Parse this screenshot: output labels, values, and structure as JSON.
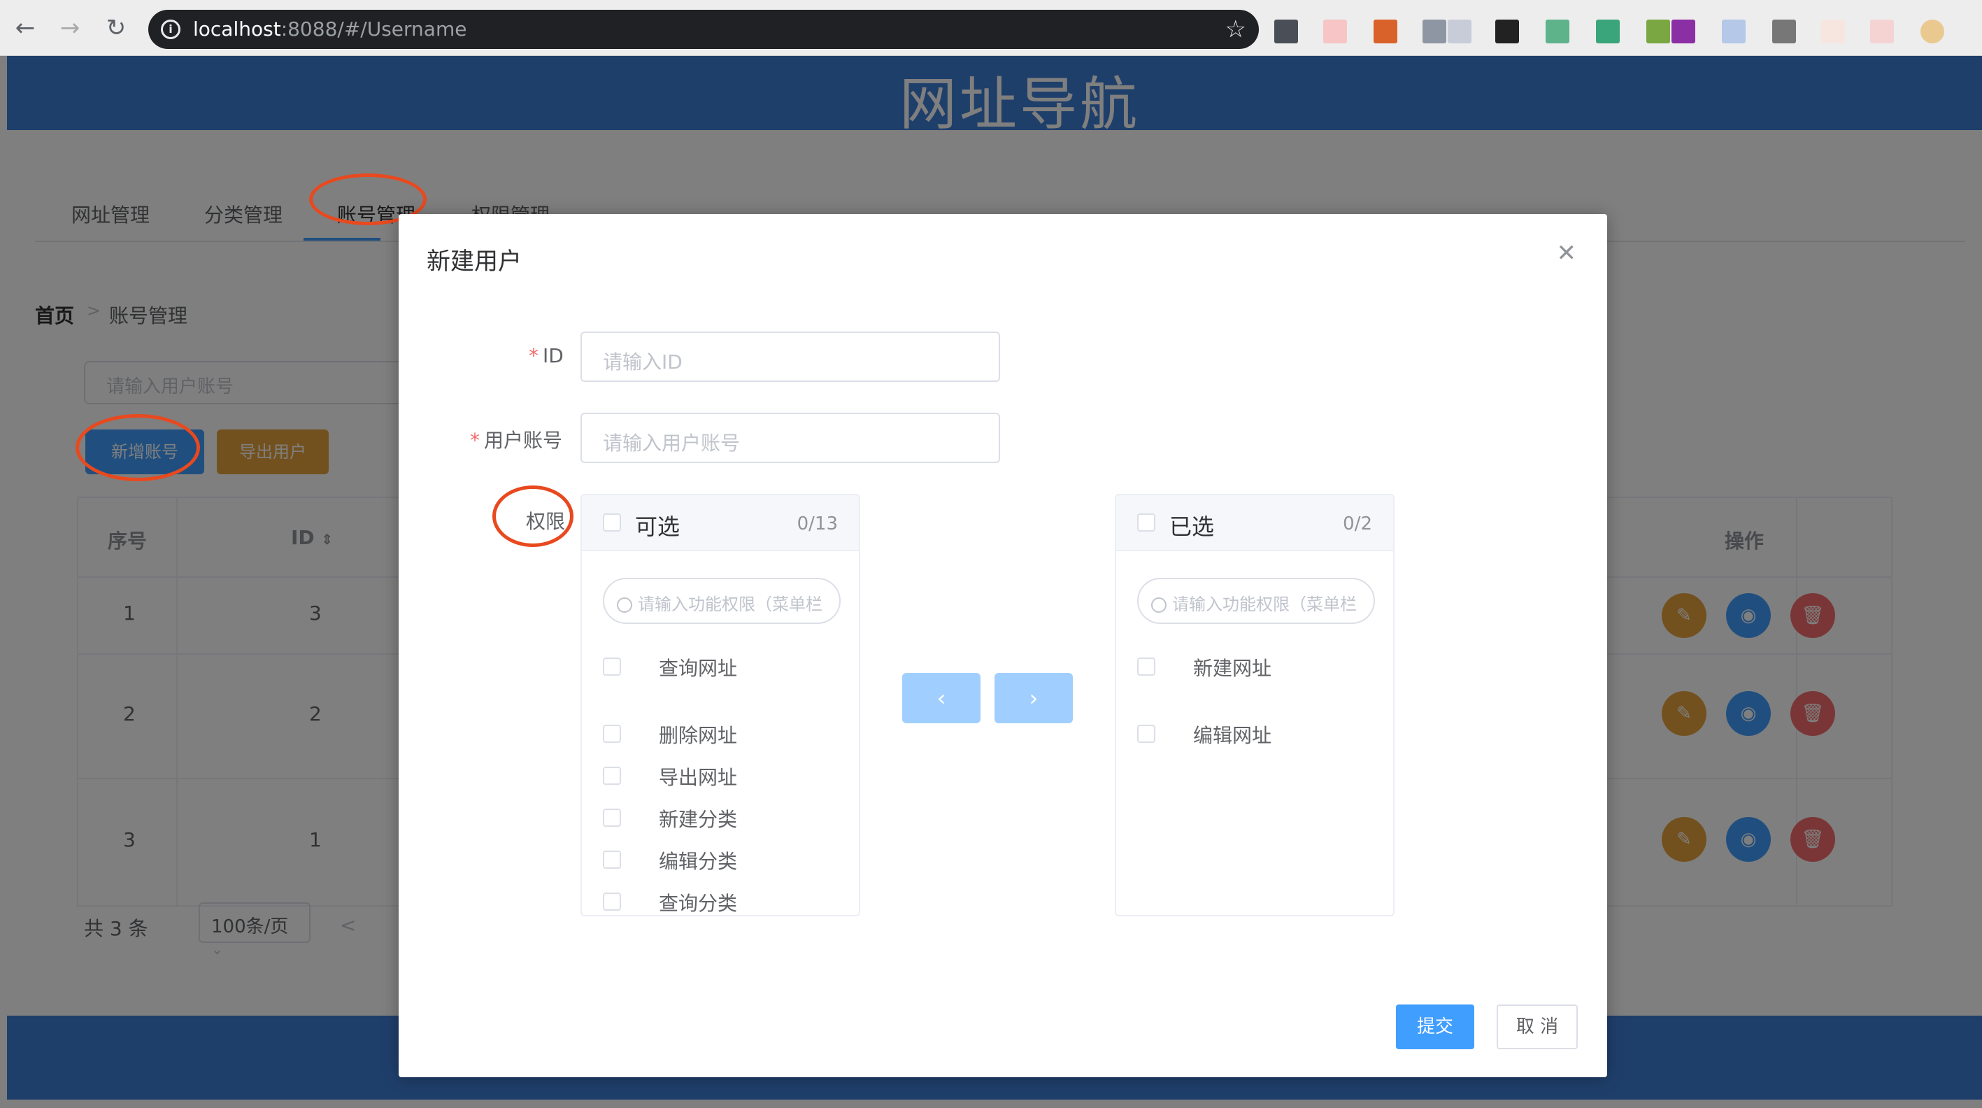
{
  "browser": {
    "url_host": "localhost",
    "url_rest": ":8088/#/Username"
  },
  "app": {
    "title": "网址导航",
    "tabs": [
      {
        "label": "网址管理"
      },
      {
        "label": "分类管理"
      },
      {
        "label": "账号管理"
      },
      {
        "label": "权限管理"
      }
    ],
    "breadcrumb": {
      "home": "首页",
      "current": "账号管理",
      "separator": ">"
    },
    "search_placeholder": "请输入用户账号",
    "add_button": "新增账号",
    "export_button": "导出用户",
    "table": {
      "columns": [
        "序号",
        "ID",
        "操作"
      ],
      "rows": [
        {
          "index": "1",
          "id": "3"
        },
        {
          "index": "2",
          "id": "2"
        },
        {
          "index": "3",
          "id": "1"
        }
      ]
    },
    "pager": {
      "total": "共 3 条",
      "page_size": "100条/页",
      "prev": "<"
    }
  },
  "dialog": {
    "title": "新建用户",
    "close_icon": "close-icon",
    "fields": {
      "id_label": "ID",
      "id_placeholder": "请输入ID",
      "account_label": "用户账号",
      "account_placeholder": "请输入用户账号",
      "perm_label": "权限"
    },
    "transfer": {
      "left": {
        "title": "可选",
        "count": "0/13",
        "filter_placeholder": "请输入功能权限（菜单栏",
        "items": [
          "查询网址",
          "删除网址",
          "导出网址",
          "新建分类",
          "编辑分类",
          "查询分类"
        ]
      },
      "right": {
        "title": "已选",
        "count": "0/2",
        "filter_placeholder": "请输入功能权限（菜单栏",
        "items": [
          "新建网址",
          "编辑网址"
        ]
      },
      "to_left": "‹",
      "to_right": "›"
    },
    "submit": "提交",
    "cancel": "取 消"
  },
  "colors": {
    "primary": "#409eff",
    "warning": "#e6a23c",
    "danger": "#f56c6c",
    "header": "#3e7fd6",
    "annotation": "#e8491e"
  }
}
